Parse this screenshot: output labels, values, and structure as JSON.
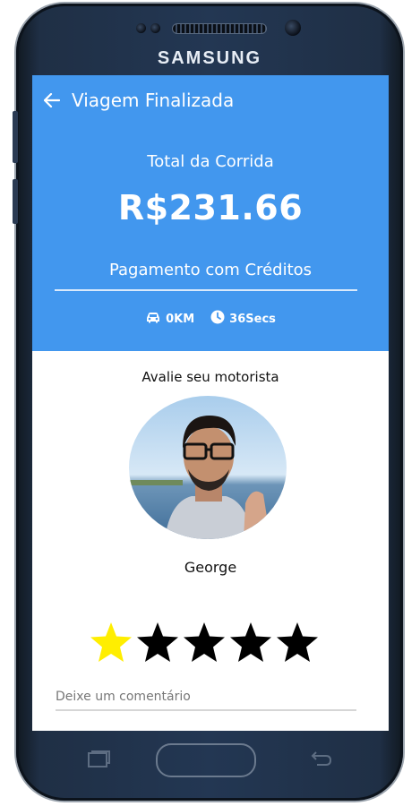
{
  "device": {
    "brand": "SAMSUNG"
  },
  "header": {
    "title": "Viagem Finalizada",
    "back_icon": "arrow-left-icon"
  },
  "summary": {
    "total_label": "Total da Corrida",
    "amount": "R$231.66",
    "payment_method": "Pagamento com Créditos",
    "distance": "0KM",
    "duration": "36Secs"
  },
  "rating": {
    "prompt": "Avalie seu motorista",
    "driver_name": "George",
    "stars_total": 5,
    "stars_selected": 1,
    "selected_color": "#ffee00",
    "unselected_color": "#000000"
  },
  "comment": {
    "placeholder": "Deixe um comentário",
    "value": ""
  },
  "colors": {
    "primary": "#4297ee"
  }
}
